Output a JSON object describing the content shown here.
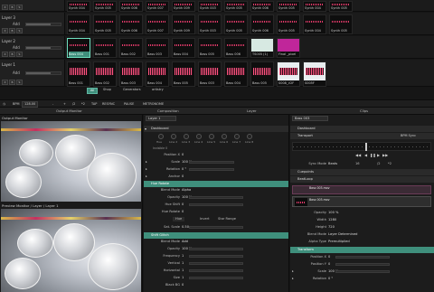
{
  "layers": [
    {
      "name": "",
      "clips": [
        "Synth 004",
        "Synth 005",
        "Synth 006",
        "Synth 007",
        "Synth 009",
        "Synth 003",
        "Synth 005",
        "Synth 006",
        "Synth 005",
        "Synth 004",
        "Synth 005"
      ],
      "top_labels": [
        "Column 3",
        "Column 4",
        "Column 5",
        "Column 6"
      ]
    },
    {
      "name": "Layer 3",
      "clips": [
        "Synth 004",
        "Synth 005",
        "Synth 006",
        "Synth 007",
        "Synth 009",
        "Synth 003",
        "Synth 005",
        "Synth 006",
        "Synth 005",
        "Synth 004",
        "Synth 005"
      ]
    },
    {
      "name": "Layer 2",
      "clips": [
        "Bass 004",
        "Bass 001",
        "Bass 002",
        "Bass 003",
        "Bass 004",
        "Bass 005",
        "Bass 006",
        "TS005 (1)",
        "Final _pixel"
      ]
    },
    {
      "name": "Layer 1",
      "clips": [
        "Bass 001",
        "Bass 002",
        "Bass 003",
        "Bass 004",
        "Bass 005",
        "Bass 003",
        "Bass 004",
        "Bass 005",
        "S008_V2F",
        "S005F"
      ]
    }
  ],
  "layer_controls": {
    "add": "Add",
    "s": "S",
    "b": "B",
    "x": "X"
  },
  "toolbar": {
    "bpm_label": "BPM",
    "bpm_value": "128.00",
    "minus": "-",
    "plus": "+",
    "div2": "/2",
    "times2": "*2",
    "tap": "TAP",
    "resync": "RESYNC",
    "pause": "PAUSE",
    "metronome": "METRONOME",
    "btn_all": "All",
    "btn_shop": "Shop",
    "btn_generators": "Generators",
    "btn_artistry": "artistry"
  },
  "tabs": {
    "output": "Output Monitor",
    "composition": "Composition",
    "layer": "Layer",
    "clips": "Clips"
  },
  "left_panel": {
    "output_title": "Output Monitor",
    "preview_title": "Preview Monitor / Layer / Layer 1"
  },
  "layer_panel": {
    "layer_name": "Layer 1",
    "dashboard": "Dashboard",
    "dash_labels": [
      "Hue",
      "Line 2",
      "Line 3",
      "Line 4",
      "Line 5",
      "Line 6",
      "Line 7",
      "Line 8"
    ],
    "dash_link": "Invisible  0",
    "position": {
      "label": "Position X",
      "value": "0"
    },
    "scale": {
      "label": "Scale",
      "value": "100 %"
    },
    "rotation": {
      "label": "Rotation",
      "value": "0 °"
    },
    "anchor": {
      "label": "Anchor",
      "value": "0"
    },
    "hue_rotate": "Hue Rotate",
    "blend_mode": {
      "label": "Blend Mode",
      "value": "Alpha"
    },
    "opacity": {
      "label": "Opacity",
      "value": "100 %"
    },
    "hue_shift": {
      "label": "Hue Shift",
      "value": "0"
    },
    "hue_rotate_row": {
      "label": "Hue Rotate",
      "value": "0"
    },
    "hue_row": {
      "hue": "Hue",
      "invert": "Invert",
      "star": "Star Range"
    },
    "sat_scale": {
      "label": "Sat. Scale",
      "value": "0.50"
    },
    "shift_glitch": "Shift Glitch",
    "sg_blend": {
      "label": "Blend Mode",
      "value": "Add"
    },
    "sg_opacity": {
      "label": "Opacity",
      "value": "100 %"
    },
    "frequency": {
      "label": "Frequency",
      "value": "1"
    },
    "vertical": {
      "label": "Vertical",
      "value": "1"
    },
    "horizontal": {
      "label": "Horizontal",
      "value": "1"
    },
    "size": {
      "label": "Size",
      "value": "1"
    },
    "black_bg": {
      "label": "Black BG",
      "value": "0"
    }
  },
  "clip_panel": {
    "clip_name": "Bass 003",
    "dashboard": "Dashboard",
    "transport": "Transport",
    "bpm_sync": "BPM Sync",
    "sync_mode": {
      "label": "Sync Mode",
      "value": "Beats"
    },
    "beats": "16",
    "div2": "/2",
    "times2": "*2",
    "cuepoints": "Cuepoints",
    "beatloop": "BeatLoop",
    "clip_info_1": "Bass 003.mov",
    "clip_info_2": "Bass 003.mov",
    "opacity": {
      "label": "Opacity",
      "value": "100 %"
    },
    "width": {
      "label": "Width",
      "value": "1280"
    },
    "height": {
      "label": "Height",
      "value": "720"
    },
    "blend_mode": {
      "label": "Blend Mode",
      "value": "Layer Determined"
    },
    "alpha_type": {
      "label": "Alpha Type",
      "value": "Premultiplied"
    },
    "transform": "Transform",
    "position_x": {
      "label": "Position X",
      "value": "0"
    },
    "position_y": {
      "label": "Position Y",
      "value": "0"
    },
    "scale": {
      "label": "Scale",
      "value": "100 %"
    },
    "rotation": {
      "label": "Rotation",
      "value": "0 °"
    }
  },
  "colors": {
    "accent": "#3f8f7c",
    "wave": "#e33a6a",
    "bg": "#161616"
  }
}
